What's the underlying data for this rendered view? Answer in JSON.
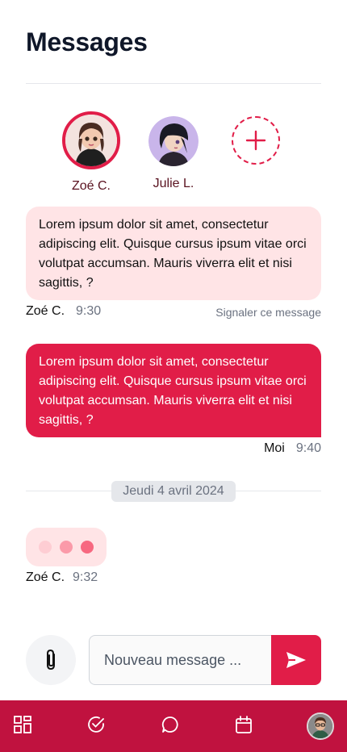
{
  "header": {
    "title": "Messages"
  },
  "contacts": [
    {
      "name": "Zoé C.",
      "active": true
    },
    {
      "name": "Julie L.",
      "active": false
    }
  ],
  "add_contact_icon": "plus-icon",
  "messages": [
    {
      "direction": "incoming",
      "text": "Lorem ipsum dolor sit amet, consectetur adipiscing elit. Quisque cursus ipsum vitae orci volutpat accumsan. Mauris viverra elit et nisi sagittis, ?",
      "author": "Zoé C.",
      "time": "9:30",
      "report_label": "Signaler ce message"
    },
    {
      "direction": "outgoing",
      "text": "Lorem ipsum dolor sit amet, consectetur adipiscing elit. Quisque cursus ipsum vitae orci volutpat accumsan. Mauris viverra elit et nisi sagittis, ?",
      "author": "Moi",
      "time": "9:40"
    }
  ],
  "date_separator": "Jeudi 4 avril 2024",
  "typing": {
    "author": "Zoé C.",
    "time": "9:32"
  },
  "composer": {
    "placeholder": "Nouveau message ...",
    "attach_icon": "paperclip-icon",
    "send_icon": "send-icon"
  },
  "bottom_nav": [
    {
      "icon": "dashboard-icon"
    },
    {
      "icon": "check-circle-icon"
    },
    {
      "icon": "chat-bubble-icon"
    },
    {
      "icon": "calendar-icon"
    },
    {
      "icon": "profile-avatar"
    }
  ],
  "colors": {
    "accent": "#e11d48",
    "nav_bg": "#c0123f",
    "bubble_in": "#ffe4e6",
    "title": "#0f1729"
  }
}
